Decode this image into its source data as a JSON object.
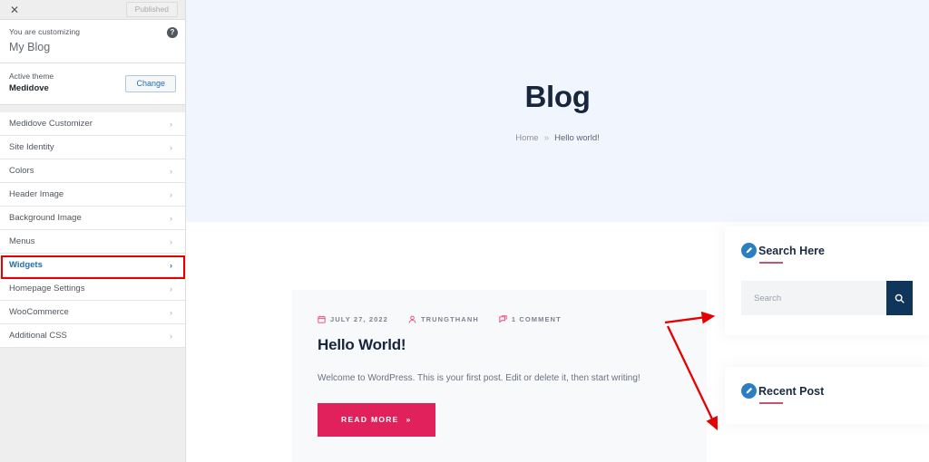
{
  "customizer": {
    "close_icon": "close-icon",
    "publish_label": "Published",
    "customizing_label": "You are customizing",
    "site_title": "My Blog",
    "help_icon": "?",
    "active_theme_label": "Active theme",
    "active_theme_name": "Medidove",
    "change_label": "Change",
    "items": [
      {
        "label": "Medidove Customizer",
        "active": false
      },
      {
        "label": "Site Identity",
        "active": false
      },
      {
        "label": "Colors",
        "active": false
      },
      {
        "label": "Header Image",
        "active": false
      },
      {
        "label": "Background Image",
        "active": false
      },
      {
        "label": "Menus",
        "active": false
      },
      {
        "label": "Widgets",
        "active": true
      },
      {
        "label": "Homepage Settings",
        "active": false
      },
      {
        "label": "WooCommerce",
        "active": false
      },
      {
        "label": "Additional CSS",
        "active": false
      }
    ],
    "highlight_color": "#e60000",
    "active_color": "#2271b1"
  },
  "preview": {
    "hero": {
      "title": "Blog",
      "breadcrumb_home": "Home",
      "breadcrumb_sep": "»",
      "breadcrumb_current": "Hello world!"
    },
    "post": {
      "date": "JULY 27, 2022",
      "author": "TRUNGTHANH",
      "comments": "1 COMMENT",
      "title": "Hello World!",
      "excerpt": "Welcome to WordPress. This is your first post. Edit or delete it, then start writing!",
      "read_more": "READ MORE",
      "read_more_arrow": "»",
      "accent_color": "#e1215b"
    },
    "widgets": [
      {
        "title": "Search Here",
        "edit_icon": "pencil-icon",
        "search_placeholder": "Search",
        "search_value": "",
        "button_icon": "search-icon",
        "button_color": "#10355a"
      },
      {
        "title": "Recent Post",
        "edit_icon": "pencil-icon"
      }
    ]
  },
  "annotations": {
    "arrow_color": "#e60000",
    "arrows": 2
  }
}
